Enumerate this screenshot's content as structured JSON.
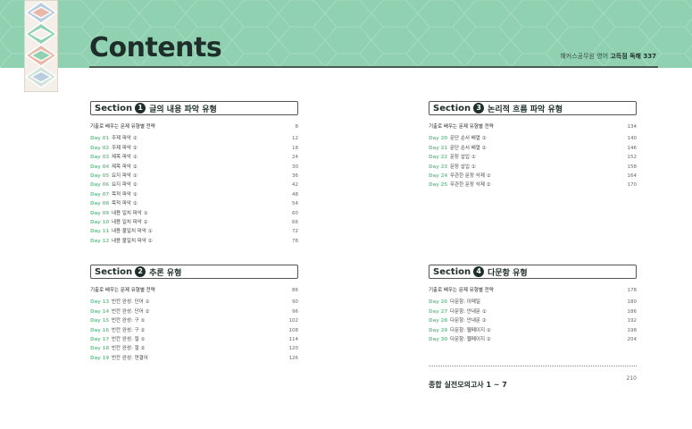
{
  "header": {
    "title": "Contents",
    "publisher": "해커스공무원 영어",
    "book": "고득점 독해 337",
    "colors": {
      "band": "#8fd1b0",
      "accent": "#7cc59c",
      "dark": "#1e2e2a"
    }
  },
  "sections": [
    {
      "word": "Section",
      "number": "1",
      "title": "글의 내용 파악 유형",
      "intro": {
        "label": "기출로 배우는 문제 유형별 전략",
        "page": "8"
      },
      "items": [
        {
          "day": "Day 01",
          "title": "주제 파악 ①",
          "page": "12"
        },
        {
          "day": "Day 02",
          "title": "주제 파악 ②",
          "page": "18"
        },
        {
          "day": "Day 03",
          "title": "제목 파악 ①",
          "page": "24"
        },
        {
          "day": "Day 04",
          "title": "제목 파악 ②",
          "page": "30"
        },
        {
          "day": "Day 05",
          "title": "요지 파악 ①",
          "page": "36"
        },
        {
          "day": "Day 06",
          "title": "요지 파악 ②",
          "page": "42"
        },
        {
          "day": "Day 07",
          "title": "목적 파악 ①",
          "page": "48"
        },
        {
          "day": "Day 08",
          "title": "목적 파악 ②",
          "page": "54"
        },
        {
          "day": "Day 09",
          "title": "내용 일치 파악 ①",
          "page": "60"
        },
        {
          "day": "Day 10",
          "title": "내용 일치 파악 ②",
          "page": "66"
        },
        {
          "day": "Day 11",
          "title": "내용 불일치 파악 ①",
          "page": "72"
        },
        {
          "day": "Day 12",
          "title": "내용 불일치 파악 ②",
          "page": "78"
        }
      ]
    },
    {
      "word": "Section",
      "number": "2",
      "title": "추론 유형",
      "intro": {
        "label": "기출로 배우는 문제 유형별 전략",
        "page": "86"
      },
      "items": [
        {
          "day": "Day 13",
          "title": "빈칸 완성: 단어 ①",
          "page": "90"
        },
        {
          "day": "Day 14",
          "title": "빈칸 완성: 단어 ②",
          "page": "96"
        },
        {
          "day": "Day 15",
          "title": "빈칸 완성: 구 ①",
          "page": "102"
        },
        {
          "day": "Day 16",
          "title": "빈칸 완성: 구 ②",
          "page": "108"
        },
        {
          "day": "Day 17",
          "title": "빈칸 완성: 절 ①",
          "page": "114"
        },
        {
          "day": "Day 18",
          "title": "빈칸 완성: 절 ②",
          "page": "120"
        },
        {
          "day": "Day 19",
          "title": "빈칸 완성: 연결어",
          "page": "126"
        }
      ]
    },
    {
      "word": "Section",
      "number": "3",
      "title": "논리적 흐름 파악 유형",
      "intro": {
        "label": "기출로 배우는 문제 유형별 전략",
        "page": "134"
      },
      "items": [
        {
          "day": "Day 20",
          "title": "문단 순서 배열 ①",
          "page": "140"
        },
        {
          "day": "Day 21",
          "title": "문단 순서 배열 ②",
          "page": "146"
        },
        {
          "day": "Day 22",
          "title": "문장 삽입 ①",
          "page": "152"
        },
        {
          "day": "Day 23",
          "title": "문장 삽입 ②",
          "page": "158"
        },
        {
          "day": "Day 24",
          "title": "무관한 문장 삭제 ①",
          "page": "164"
        },
        {
          "day": "Day 25",
          "title": "무관한 문장 삭제 ②",
          "page": "170"
        }
      ]
    },
    {
      "word": "Section",
      "number": "4",
      "title": "다문항 유형",
      "intro": {
        "label": "기출로 배우는 문제 유형별 전략",
        "page": "178"
      },
      "items": [
        {
          "day": "Day 26",
          "title": "다문항: 이메일",
          "page": "180"
        },
        {
          "day": "Day 27",
          "title": "다문항: 안내문 ①",
          "page": "186"
        },
        {
          "day": "Day 28",
          "title": "다문항: 안내문 ②",
          "page": "192"
        },
        {
          "day": "Day 29",
          "title": "다문항: 웹페이지 ①",
          "page": "198"
        },
        {
          "day": "Day 30",
          "title": "다문항: 웹페이지 ②",
          "page": "204"
        }
      ]
    }
  ],
  "final": {
    "title": "종합 실전모의고사 1 ~ 7",
    "page": "210"
  }
}
